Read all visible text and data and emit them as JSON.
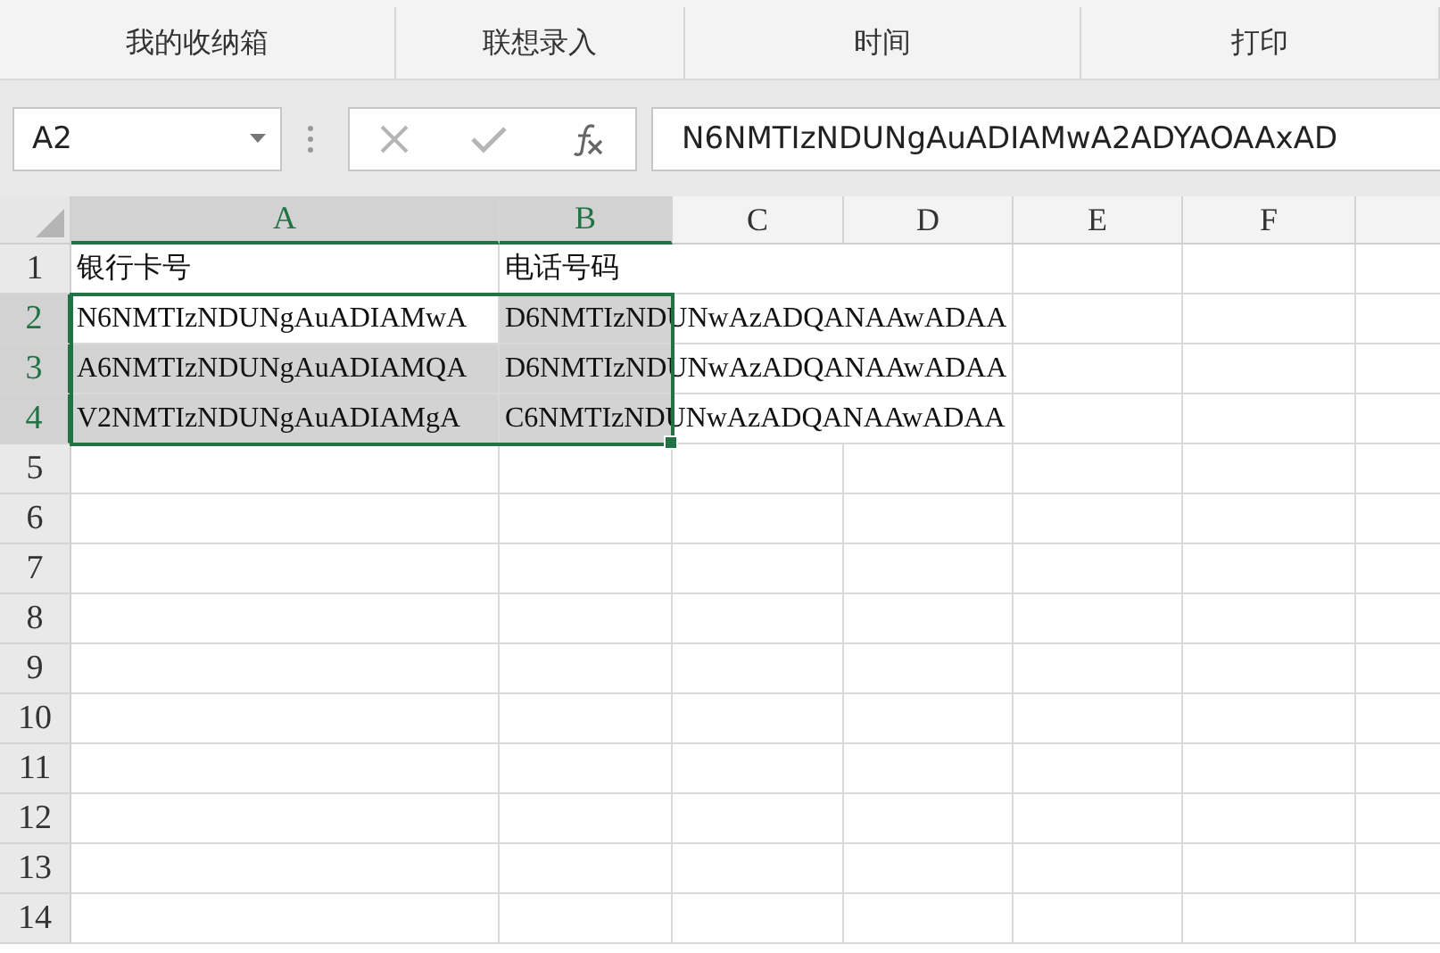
{
  "ribbon": {
    "groups": [
      {
        "label": "我的收纳箱"
      },
      {
        "label": "联想录入"
      },
      {
        "label": "时间"
      },
      {
        "label": "打印"
      }
    ]
  },
  "name_box": {
    "value": "A2"
  },
  "formula_bar": {
    "value": "N6NMTIzNDUNgAuADIAMwA2ADYAOAAxAD"
  },
  "sheet": {
    "columns": [
      {
        "label": "A",
        "selected": true
      },
      {
        "label": "B",
        "selected": true
      },
      {
        "label": "C",
        "selected": false
      },
      {
        "label": "D",
        "selected": false
      },
      {
        "label": "E",
        "selected": false
      },
      {
        "label": "F",
        "selected": false
      }
    ],
    "rows": [
      {
        "label": "1",
        "selected": false,
        "cells": [
          {
            "value": "银行卡号",
            "selected": false,
            "active": false
          },
          {
            "value": "电话号码",
            "selected": false,
            "active": false
          }
        ]
      },
      {
        "label": "2",
        "selected": true,
        "cells": [
          {
            "value": "N6NMTIzNDUNgAuADIAMwA",
            "selected": true,
            "active": true
          },
          {
            "value": "D6NMTIzNDUNwAzADQANAAwADAA",
            "selected": true,
            "active": false
          }
        ]
      },
      {
        "label": "3",
        "selected": true,
        "cells": [
          {
            "value": "A6NMTIzNDUNgAuADIAMQA",
            "selected": true,
            "active": false
          },
          {
            "value": "D6NMTIzNDUNwAzADQANAAwADAA",
            "selected": true,
            "active": false
          }
        ]
      },
      {
        "label": "4",
        "selected": true,
        "cells": [
          {
            "value": "V2NMTIzNDUNgAuADIAMgA",
            "selected": true,
            "active": false
          },
          {
            "value": "C6NMTIzNDUNwAzADQANAAwADAA",
            "selected": true,
            "active": false
          }
        ]
      },
      {
        "label": "5",
        "selected": false,
        "cells": []
      },
      {
        "label": "6",
        "selected": false,
        "cells": []
      },
      {
        "label": "7",
        "selected": false,
        "cells": []
      },
      {
        "label": "8",
        "selected": false,
        "cells": []
      },
      {
        "label": "9",
        "selected": false,
        "cells": []
      },
      {
        "label": "10",
        "selected": false,
        "cells": []
      },
      {
        "label": "11",
        "selected": false,
        "cells": []
      },
      {
        "label": "12",
        "selected": false,
        "cells": []
      },
      {
        "label": "13",
        "selected": false,
        "cells": []
      },
      {
        "label": "14",
        "selected": false,
        "cells": []
      }
    ]
  }
}
